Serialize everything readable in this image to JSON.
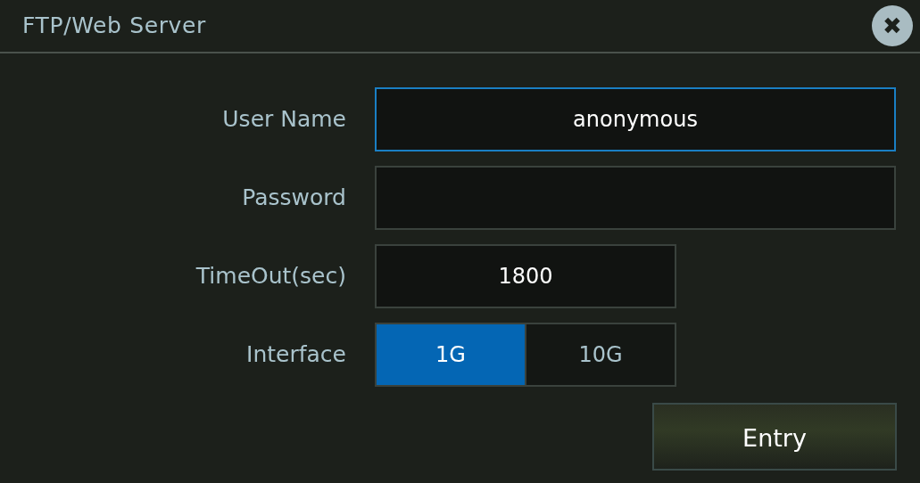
{
  "window": {
    "title": "FTP/Web Server",
    "close": "✖"
  },
  "fields": [
    {
      "kind": "wide",
      "label": "User Name",
      "value": "anonymous",
      "focused": true
    },
    {
      "kind": "wide",
      "label": "Password",
      "focused": false
    },
    {
      "kind": "narrow",
      "label": "TimeOut(sec)",
      "value": "1800",
      "focused": false
    },
    {
      "kind": "segmented",
      "label": "Interface",
      "options": [
        {
          "label": "1G",
          "selected": true
        },
        {
          "label": "10G",
          "selected": false
        }
      ]
    }
  ],
  "buttons": [
    "Entry"
  ]
}
